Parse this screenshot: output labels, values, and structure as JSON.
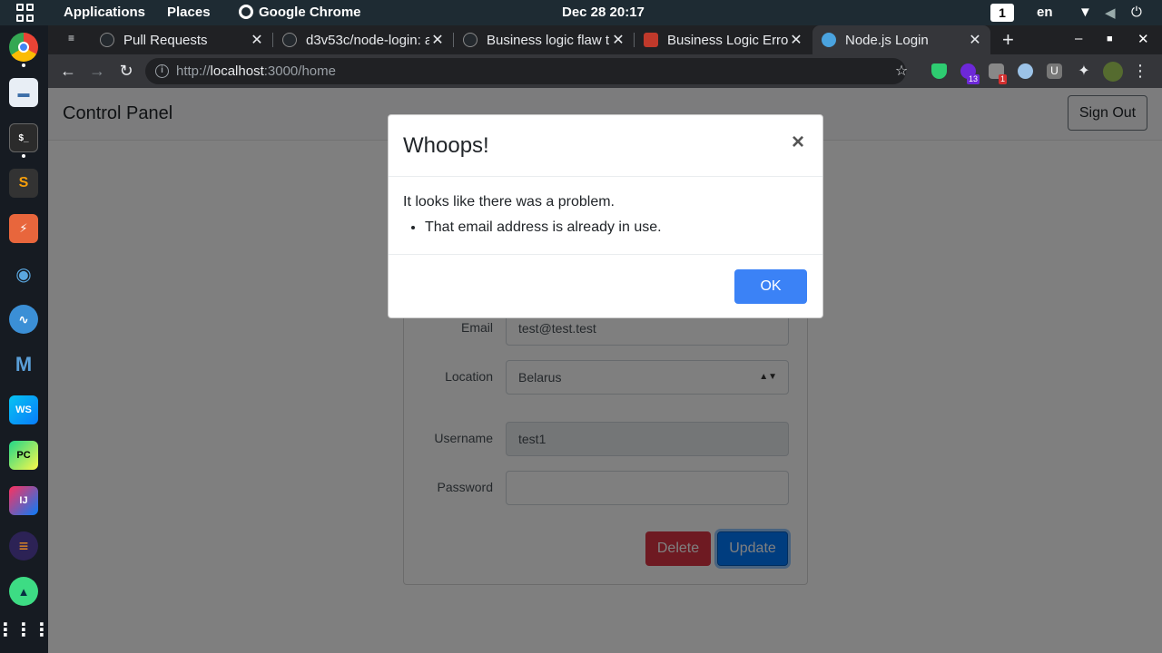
{
  "system_bar": {
    "applications": "Applications",
    "places": "Places",
    "active_app": "Google Chrome",
    "clock": "Dec 28  20:17",
    "workspace": "1",
    "language": "en"
  },
  "dock": {
    "apps": [
      "chrome",
      "files",
      "terminal",
      "sublime-text",
      "burp-suite",
      "owasp-zap",
      "wireshark",
      "metasploit",
      "webstorm",
      "pycharm",
      "intellij",
      "eclipse",
      "android-studio",
      "app-grid"
    ]
  },
  "browser": {
    "tabs": [
      {
        "title": "Pull Requests"
      },
      {
        "title": "d3v53c/node-login: a"
      },
      {
        "title": "Business logic flaw t"
      },
      {
        "title": "Business Logic Error"
      },
      {
        "title": "Node.js Login"
      }
    ],
    "url_scheme": "http://",
    "url_host": "localhost",
    "url_rest": ":3000/home",
    "extension_badges": [
      "13",
      "1"
    ]
  },
  "page": {
    "brand": "Control Panel",
    "sign_out": "Sign Out",
    "form": {
      "email_label": "Email",
      "email_value": "test@test.test",
      "location_label": "Location",
      "location_value": "Belarus",
      "username_label": "Username",
      "username_value": "test1",
      "password_label": "Password",
      "password_value": "",
      "delete_label": "Delete",
      "update_label": "Update"
    }
  },
  "modal": {
    "title": "Whoops!",
    "close": "×",
    "message": "It looks like there was a problem.",
    "errors": [
      "That email address is already in use."
    ],
    "ok_label": "OK"
  },
  "colors": {
    "primary": "#007bff",
    "danger": "#dc3545",
    "ok_button": "#3b82f6"
  }
}
